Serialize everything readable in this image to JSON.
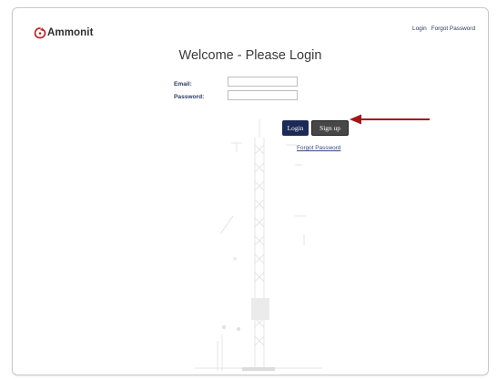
{
  "header": {
    "logo_text": "Ammonit",
    "nav": {
      "login_label": "Login",
      "forgot_label": "Forgot Password"
    }
  },
  "main": {
    "title": "Welcome - Please Login",
    "form": {
      "email_label": "Email:",
      "email_value": "",
      "password_label": "Password:",
      "password_value": "",
      "login_button": "Login",
      "signup_button": "Sign up",
      "forgot_link": "Forgot Password"
    }
  },
  "colors": {
    "brand_red": "#c0292b",
    "navy": "#1d2a55",
    "signup_gray": "#474747",
    "annotation_arrow": "#a4161a"
  },
  "icons": {
    "logo_mark": "ammonit-swirl-icon",
    "annotation": "arrow-left-icon"
  }
}
